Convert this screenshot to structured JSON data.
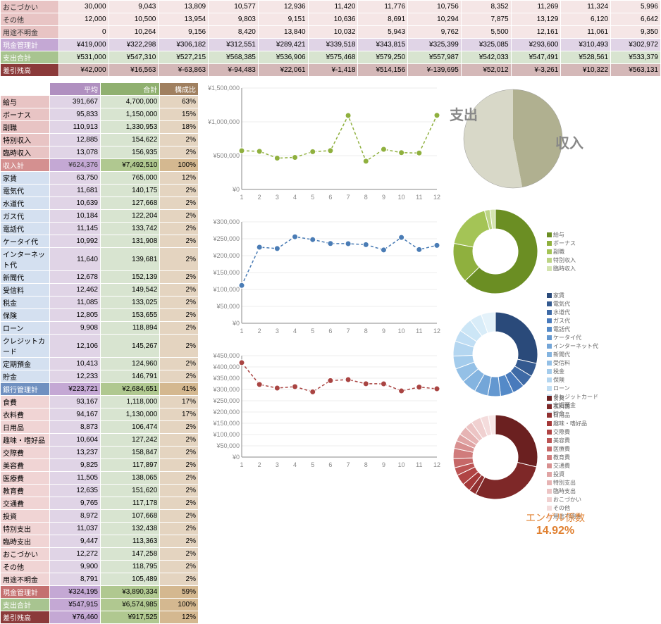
{
  "top_table": {
    "rows": [
      {
        "cls": "row-pink",
        "label": "おこづかい",
        "vals": [
          "30,000",
          "9,043",
          "13,809",
          "10,577",
          "12,936",
          "11,420",
          "11,776",
          "10,756",
          "8,352",
          "11,269",
          "11,324",
          "5,996"
        ]
      },
      {
        "cls": "row-pink",
        "label": "その他",
        "vals": [
          "12,000",
          "10,500",
          "13,954",
          "9,803",
          "9,151",
          "10,636",
          "8,691",
          "10,294",
          "7,875",
          "13,129",
          "6,120",
          "6,642"
        ]
      },
      {
        "cls": "row-pink",
        "label": "用途不明金",
        "vals": [
          "0",
          "10,264",
          "9,156",
          "8,420",
          "13,840",
          "10,032",
          "5,943",
          "9,762",
          "5,500",
          "12,161",
          "11,061",
          "9,350"
        ]
      },
      {
        "cls": "row-purple",
        "label": "現金管理計",
        "vals": [
          "¥419,000",
          "¥322,298",
          "¥306,182",
          "¥312,551",
          "¥289,421",
          "¥339,518",
          "¥343,815",
          "¥325,399",
          "¥325,085",
          "¥293,600",
          "¥310,493",
          "¥302,972"
        ]
      },
      {
        "cls": "row-green",
        "label": "支出合計",
        "vals": [
          "¥531,000",
          "¥547,310",
          "¥527,215",
          "¥568,385",
          "¥536,906",
          "¥575,468",
          "¥579,250",
          "¥557,987",
          "¥542,033",
          "¥547,491",
          "¥528,561",
          "¥533,379"
        ]
      },
      {
        "cls": "row-darkred",
        "label": "差引残高",
        "vals": [
          "¥42,000",
          "¥16,563",
          "¥-63,863",
          "¥-94,483",
          "¥22,061",
          "¥-1,418",
          "¥514,156",
          "¥-139,695",
          "¥52,012",
          "¥-3,261",
          "¥10,322",
          "¥563,131"
        ]
      }
    ]
  },
  "summary": {
    "headers": [
      "平均",
      "合計",
      "構成比"
    ],
    "income": [
      {
        "label": "給与",
        "vals": [
          "391,667",
          "4,700,000",
          "63%"
        ]
      },
      {
        "label": "ボーナス",
        "vals": [
          "95,833",
          "1,150,000",
          "15%"
        ]
      },
      {
        "label": "副職",
        "vals": [
          "110,913",
          "1,330,953",
          "18%"
        ]
      },
      {
        "label": "特別収入",
        "vals": [
          "12,885",
          "154,622",
          "2%"
        ]
      },
      {
        "label": "臨時収入",
        "vals": [
          "13,078",
          "156,935",
          "2%"
        ]
      }
    ],
    "income_total": {
      "label": "収入計",
      "vals": [
        "¥624,376",
        "¥7,492,510",
        "100%"
      ]
    },
    "bank": [
      {
        "label": "家賃",
        "vals": [
          "63,750",
          "765,000",
          "12%"
        ]
      },
      {
        "label": "電気代",
        "vals": [
          "11,681",
          "140,175",
          "2%"
        ]
      },
      {
        "label": "水道代",
        "vals": [
          "10,639",
          "127,668",
          "2%"
        ]
      },
      {
        "label": "ガス代",
        "vals": [
          "10,184",
          "122,204",
          "2%"
        ]
      },
      {
        "label": "電話代",
        "vals": [
          "11,145",
          "133,742",
          "2%"
        ]
      },
      {
        "label": "ケータイ代",
        "vals": [
          "10,992",
          "131,908",
          "2%"
        ]
      },
      {
        "label": "インターネット代",
        "vals": [
          "11,640",
          "139,681",
          "2%"
        ]
      },
      {
        "label": "新聞代",
        "vals": [
          "12,678",
          "152,139",
          "2%"
        ]
      },
      {
        "label": "受信料",
        "vals": [
          "12,462",
          "149,542",
          "2%"
        ]
      },
      {
        "label": "税金",
        "vals": [
          "11,085",
          "133,025",
          "2%"
        ]
      },
      {
        "label": "保険",
        "vals": [
          "12,805",
          "153,655",
          "2%"
        ]
      },
      {
        "label": "ローン",
        "vals": [
          "9,908",
          "118,894",
          "2%"
        ]
      },
      {
        "label": "クレジットカード",
        "vals": [
          "12,106",
          "145,267",
          "2%"
        ]
      },
      {
        "label": "定期預金",
        "vals": [
          "10,413",
          "124,960",
          "2%"
        ]
      },
      {
        "label": "貯金",
        "vals": [
          "12,233",
          "146,791",
          "2%"
        ]
      }
    ],
    "bank_total": {
      "label": "銀行管理計",
      "vals": [
        "¥223,721",
        "¥2,684,651",
        "41%"
      ]
    },
    "cash": [
      {
        "label": "食費",
        "vals": [
          "93,167",
          "1,118,000",
          "17%"
        ]
      },
      {
        "label": "衣料費",
        "vals": [
          "94,167",
          "1,130,000",
          "17%"
        ]
      },
      {
        "label": "日用品",
        "vals": [
          "8,873",
          "106,474",
          "2%"
        ]
      },
      {
        "label": "趣味・嗜好品",
        "vals": [
          "10,604",
          "127,242",
          "2%"
        ]
      },
      {
        "label": "交際費",
        "vals": [
          "13,237",
          "158,847",
          "2%"
        ]
      },
      {
        "label": "美容費",
        "vals": [
          "9,825",
          "117,897",
          "2%"
        ]
      },
      {
        "label": "医療費",
        "vals": [
          "11,505",
          "138,065",
          "2%"
        ]
      },
      {
        "label": "教育費",
        "vals": [
          "12,635",
          "151,620",
          "2%"
        ]
      },
      {
        "label": "交通費",
        "vals": [
          "9,765",
          "117,178",
          "2%"
        ]
      },
      {
        "label": "投資",
        "vals": [
          "8,972",
          "107,668",
          "2%"
        ]
      },
      {
        "label": "特別支出",
        "vals": [
          "11,037",
          "132,438",
          "2%"
        ]
      },
      {
        "label": "臨時支出",
        "vals": [
          "9,447",
          "113,363",
          "2%"
        ]
      },
      {
        "label": "おこづかい",
        "vals": [
          "12,272",
          "147,258",
          "2%"
        ]
      },
      {
        "label": "その他",
        "vals": [
          "9,900",
          "118,795",
          "2%"
        ]
      },
      {
        "label": "用途不明金",
        "vals": [
          "8,791",
          "105,489",
          "2%"
        ]
      }
    ],
    "cash_total": {
      "label": "現金管理計",
      "vals": [
        "¥324,195",
        "¥3,890,334",
        "59%"
      ]
    },
    "exp_total": {
      "label": "支出合計",
      "vals": [
        "¥547,915",
        "¥6,574,985",
        "100%"
      ]
    },
    "balance": {
      "label": "差引残高",
      "vals": [
        "¥76,460",
        "¥917,525",
        "12%"
      ]
    }
  },
  "chart_data": [
    {
      "type": "line",
      "x": [
        1,
        2,
        3,
        4,
        5,
        6,
        7,
        8,
        9,
        10,
        11,
        12
      ],
      "values": [
        573000,
        563873,
        463352,
        473902,
        558967,
        574050,
        1093406,
        418292,
        594045,
        544230,
        538883,
        1096510
      ],
      "ylim": [
        0,
        1500000
      ],
      "yticks": [
        "¥0",
        "¥500,000",
        "¥1,000,000",
        "¥1,500,000"
      ],
      "color": "#8fb03e"
    },
    {
      "type": "line",
      "x": [
        1,
        2,
        3,
        4,
        5,
        6,
        7,
        8,
        9,
        10,
        11,
        12
      ],
      "values": [
        112000,
        225012,
        221033,
        255834,
        247485,
        235950,
        235435,
        232588,
        216948,
        253891,
        218068,
        230407
      ],
      "ylim": [
        0,
        300000
      ],
      "yticks": [
        "¥0",
        "¥50,000",
        "¥100,000",
        "¥150,000",
        "¥200,000",
        "¥250,000",
        "¥300,000"
      ],
      "color": "#4a7cb5"
    },
    {
      "type": "line",
      "x": [
        1,
        2,
        3,
        4,
        5,
        6,
        7,
        8,
        9,
        10,
        11,
        12
      ],
      "values": [
        419000,
        322298,
        306182,
        312551,
        289421,
        339518,
        343815,
        325399,
        325085,
        293600,
        310493,
        302972
      ],
      "ylim": [
        0,
        450000
      ],
      "yticks": [
        "¥0",
        "¥50,000",
        "¥100,000",
        "¥150,000",
        "¥200,000",
        "¥250,000",
        "¥300,000",
        "¥350,000",
        "¥400,000",
        "¥450,000"
      ],
      "color": "#a94442"
    }
  ],
  "pie": {
    "labels": [
      "支出",
      "収入"
    ]
  },
  "donuts": [
    {
      "items": [
        {
          "name": "給与",
          "value": 4700000,
          "color": "#6b8e23"
        },
        {
          "name": "ボーナス",
          "value": 1150000,
          "color": "#8fb03e"
        },
        {
          "name": "副職",
          "value": 1330953,
          "color": "#a4c456"
        },
        {
          "name": "特別収入",
          "value": 154622,
          "color": "#bcd484"
        },
        {
          "name": "臨時収入",
          "value": 156935,
          "color": "#d4e4b0"
        }
      ]
    },
    {
      "items": [
        {
          "name": "家賃",
          "value": 765000,
          "color": "#2a4a7a"
        },
        {
          "name": "電気代",
          "value": 140175,
          "color": "#345a90"
        },
        {
          "name": "水道代",
          "value": 127668,
          "color": "#3e6aa6"
        },
        {
          "name": "ガス代",
          "value": 122204,
          "color": "#487abc"
        },
        {
          "name": "電話代",
          "value": 133742,
          "color": "#548ac8"
        },
        {
          "name": "ケータイ代",
          "value": 131908,
          "color": "#6498d0"
        },
        {
          "name": "インターネット代",
          "value": 139681,
          "color": "#74a6d8"
        },
        {
          "name": "新聞代",
          "value": 152139,
          "color": "#84b4e0"
        },
        {
          "name": "受信料",
          "value": 149542,
          "color": "#94c0e6"
        },
        {
          "name": "税金",
          "value": 133025,
          "color": "#a4ccec"
        },
        {
          "name": "保険",
          "value": 153655,
          "color": "#b4d6f0"
        },
        {
          "name": "ローン",
          "value": 118894,
          "color": "#c0def4"
        },
        {
          "name": "クレジットカード",
          "value": 145267,
          "color": "#cce6f6"
        },
        {
          "name": "定期預金",
          "value": 124960,
          "color": "#d8ecf8"
        },
        {
          "name": "貯金",
          "value": 146791,
          "color": "#e4f2fa"
        }
      ]
    },
    {
      "items": [
        {
          "name": "食費",
          "value": 1118000,
          "color": "#6b2020"
        },
        {
          "name": "衣料費",
          "value": 1130000,
          "color": "#7e2828"
        },
        {
          "name": "日用品",
          "value": 106474,
          "color": "#913030"
        },
        {
          "name": "趣味・嗜好品",
          "value": 127242,
          "color": "#a43838"
        },
        {
          "name": "交際費",
          "value": 158847,
          "color": "#b04444"
        },
        {
          "name": "美容費",
          "value": 117897,
          "color": "#bc5454"
        },
        {
          "name": "医療費",
          "value": 138065,
          "color": "#c66868"
        },
        {
          "name": "教育費",
          "value": 151620,
          "color": "#d07c7c"
        },
        {
          "name": "交通費",
          "value": 117178,
          "color": "#d89090"
        },
        {
          "name": "投資",
          "value": 107668,
          "color": "#e0a4a4"
        },
        {
          "name": "特別支出",
          "value": 132438,
          "color": "#e6b4b4"
        },
        {
          "name": "臨時支出",
          "value": 113363,
          "color": "#ecc4c4"
        },
        {
          "name": "おこづかい",
          "value": 147258,
          "color": "#f0d0d0"
        },
        {
          "name": "その他",
          "value": 118795,
          "color": "#f4dcdc"
        },
        {
          "name": "用途不明金",
          "value": 105489,
          "color": "#f8e8e8"
        }
      ]
    }
  ],
  "engel": {
    "label": "エンゲル係数",
    "value": "14.92%"
  }
}
